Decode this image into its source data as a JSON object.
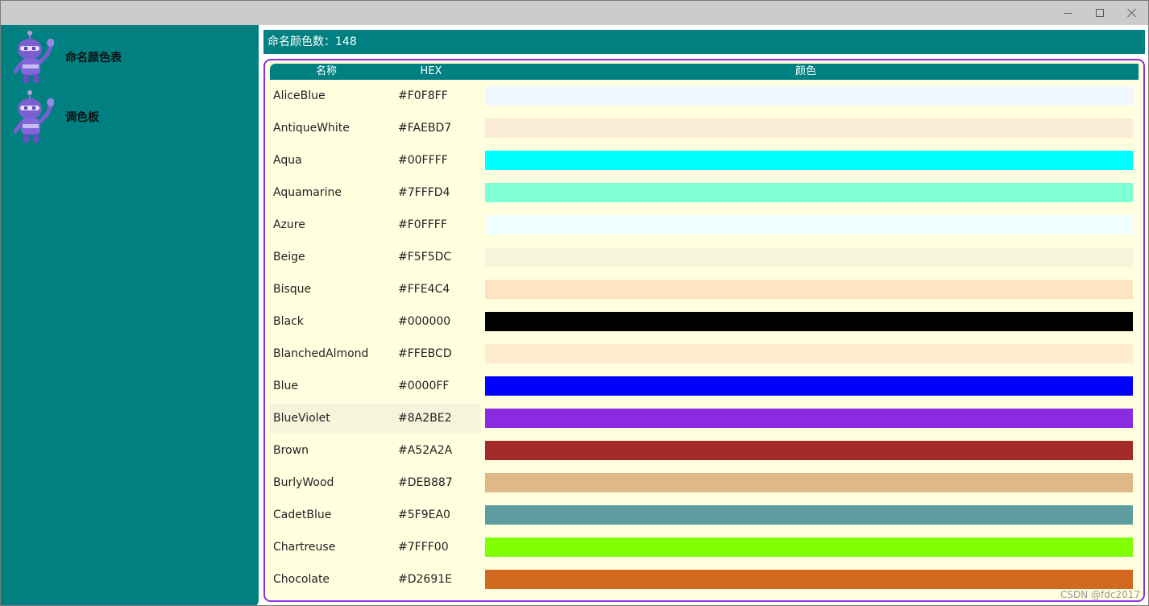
{
  "window": {
    "buttons": {
      "minimize": "minimize-icon",
      "maximize": "maximize-icon",
      "close": "close-icon"
    }
  },
  "sidebar": {
    "items": [
      {
        "label": "命名颜色表",
        "icon": "robot-icon"
      },
      {
        "label": "调色板",
        "icon": "robot-icon"
      }
    ]
  },
  "header": {
    "count_text": "命名颜色数：148"
  },
  "table": {
    "columns": [
      "名称",
      "HEX",
      "颜色"
    ],
    "highlight_color": "#F5F5DC",
    "rows": [
      {
        "name": "AliceBlue",
        "hex": "#F0F8FF"
      },
      {
        "name": "AntiqueWhite",
        "hex": "#FAEBD7"
      },
      {
        "name": "Aqua",
        "hex": "#00FFFF"
      },
      {
        "name": "Aquamarine",
        "hex": "#7FFFD4"
      },
      {
        "name": "Azure",
        "hex": "#F0FFFF"
      },
      {
        "name": "Beige",
        "hex": "#F5F5DC"
      },
      {
        "name": "Bisque",
        "hex": "#FFE4C4"
      },
      {
        "name": "Black",
        "hex": "#000000"
      },
      {
        "name": "BlanchedAlmond",
        "hex": "#FFEBCD"
      },
      {
        "name": "Blue",
        "hex": "#0000FF"
      },
      {
        "name": "BlueViolet",
        "hex": "#8A2BE2"
      },
      {
        "name": "Brown",
        "hex": "#A52A2A"
      },
      {
        "name": "BurlyWood",
        "hex": "#DEB887"
      },
      {
        "name": "CadetBlue",
        "hex": "#5F9EA0"
      },
      {
        "name": "Chartreuse",
        "hex": "#7FFF00"
      },
      {
        "name": "Chocolate",
        "hex": "#D2691E"
      }
    ]
  },
  "colors": {
    "accent": "#008080",
    "frame_border": "#8A2BE2",
    "row_background": "#FFFFE0"
  },
  "watermark": "CSDN @fdc2017"
}
